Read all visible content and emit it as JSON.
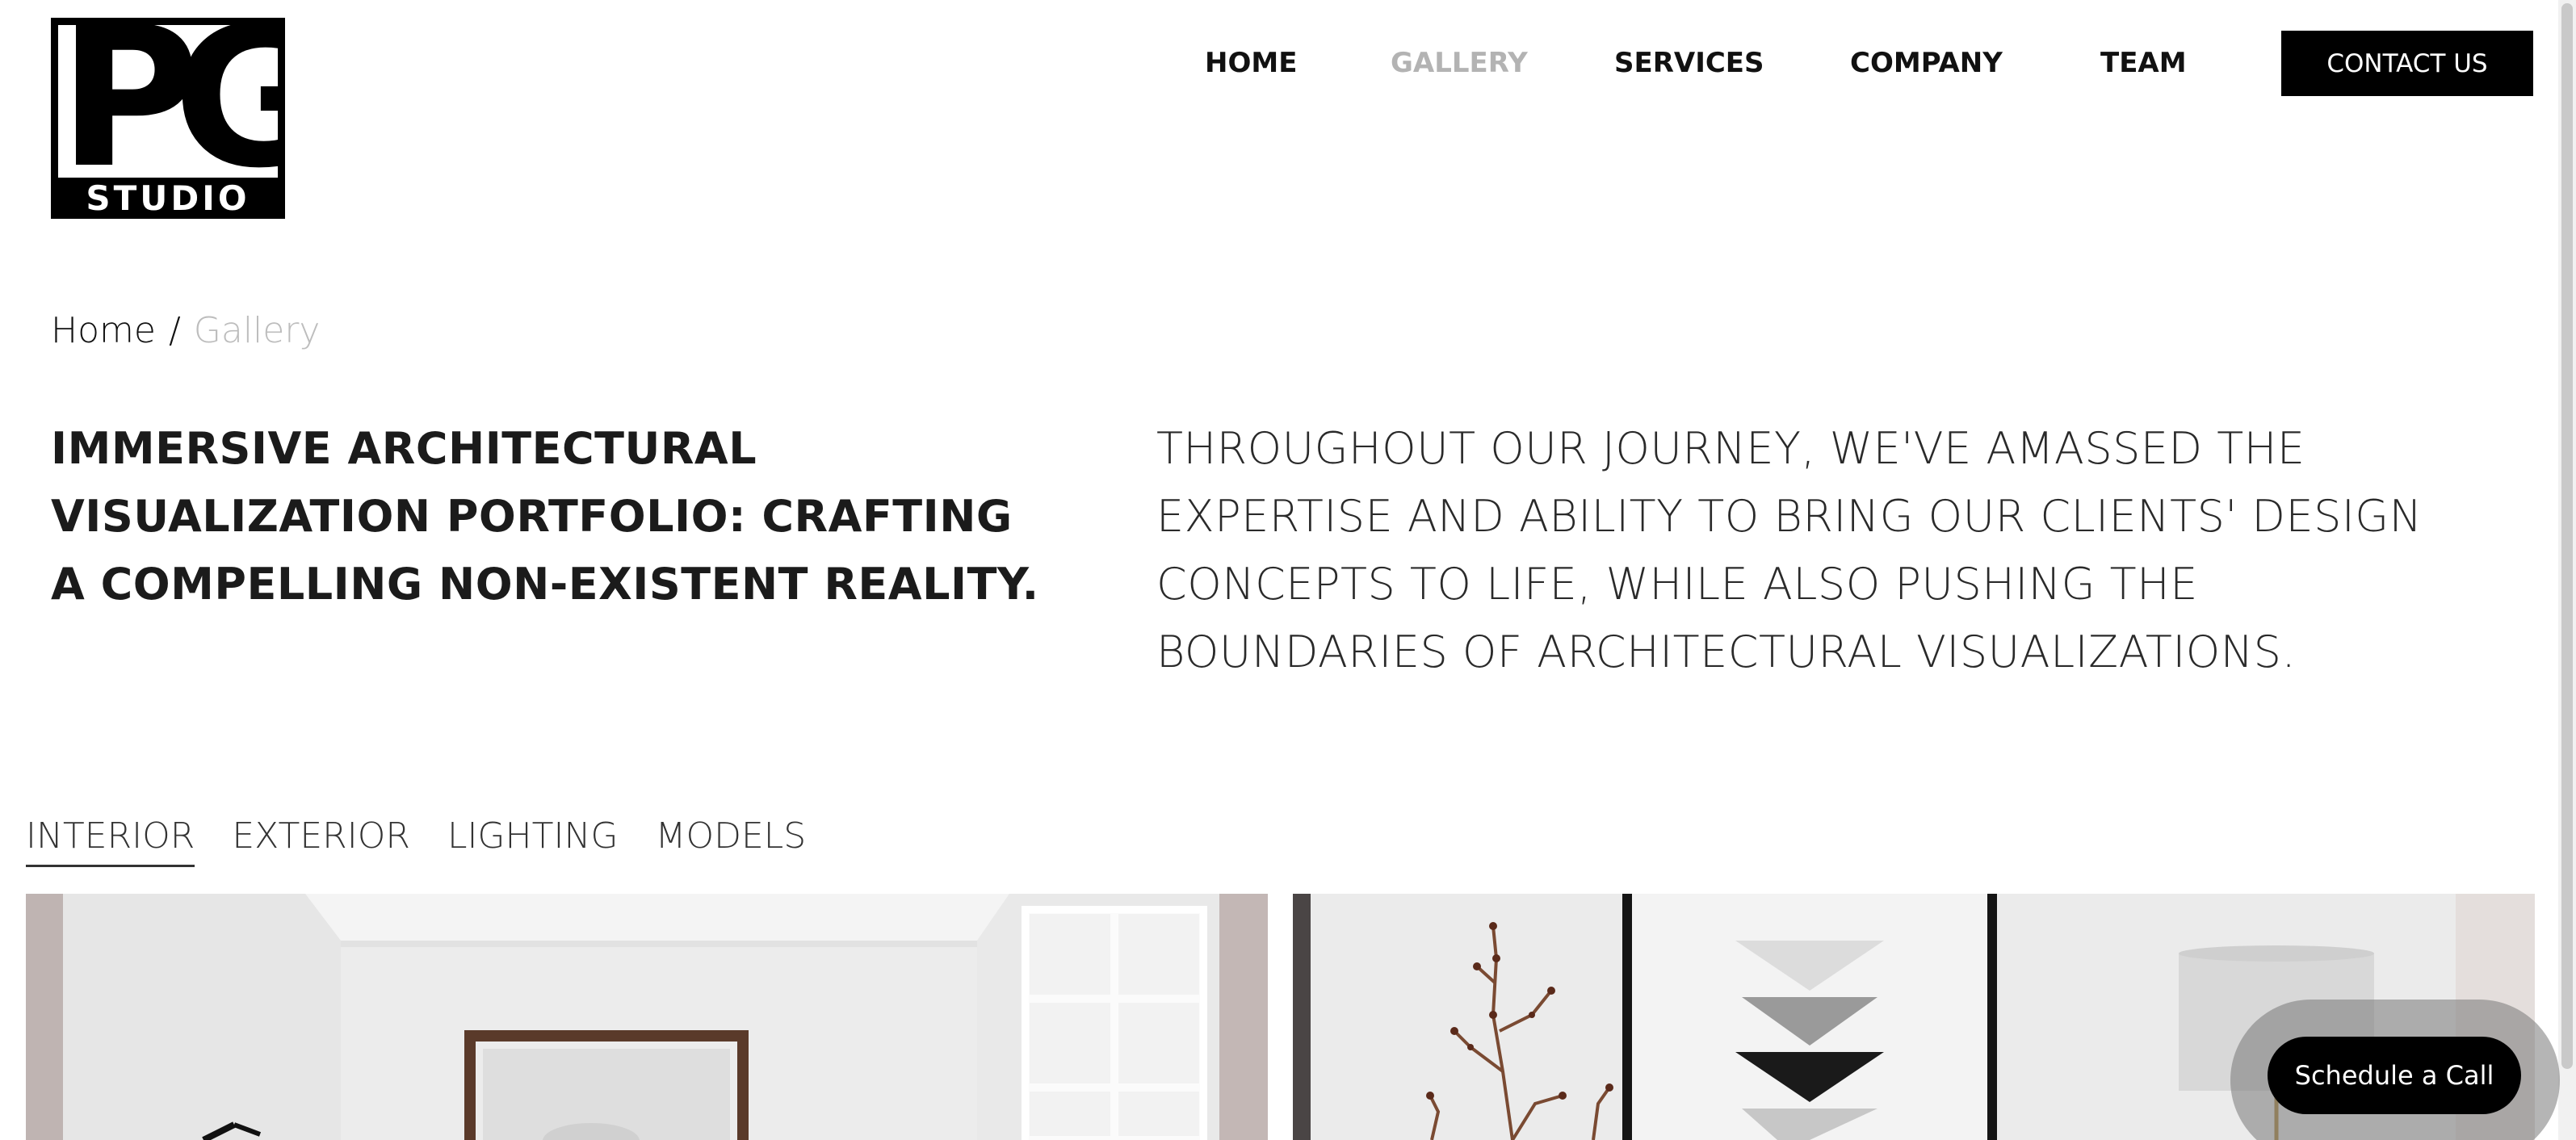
{
  "logo": {
    "mark_text": "PG",
    "wordmark": "STUDIO"
  },
  "nav": {
    "items": [
      {
        "label": "HOME"
      },
      {
        "label": "GALLERY"
      },
      {
        "label": "SERVICES"
      },
      {
        "label": "COMPANY"
      },
      {
        "label": "TEAM"
      }
    ],
    "active": "GALLERY",
    "contact_label": "CONTACT US"
  },
  "breadcrumb": {
    "home": "Home",
    "separator": "/",
    "current": "Gallery"
  },
  "headline": "IMMERSIVE ARCHITECTURAL VISUALIZATION PORTFOLIO: CRAFTING A COMPELLING NON-EXISTENT REALITY.",
  "intro": "THROUGHOUT OUR JOURNEY, WE'VE AMASSED THE EXPERTISE AND ABILITY TO BRING OUR CLIENTS' DESIGN CONCEPTS TO LIFE, WHILE ALSO PUSHING THE BOUNDARIES OF ARCHITECTURAL VISUALIZATIONS.",
  "tabs": [
    {
      "label": "INTERIOR"
    },
    {
      "label": "EXTERIOR"
    },
    {
      "label": "LIGHTING"
    },
    {
      "label": "MODELS"
    }
  ],
  "active_tab": "INTERIOR",
  "cta": {
    "label": "Schedule a Call"
  },
  "colors": {
    "accent": "#000000",
    "muted": "#b3b3b3",
    "background": "#ffffff"
  }
}
